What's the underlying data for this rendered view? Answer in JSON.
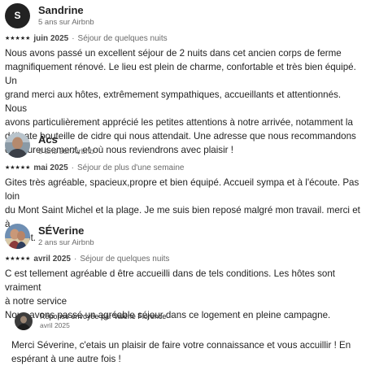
{
  "reviews": [
    {
      "avatar_letter": "S",
      "name": "Sandrine",
      "since": "5 ans sur Airbnb",
      "stars": "★★★★★",
      "date": "juin 2025",
      "stay": "Séjour de quelques nuits",
      "text": "Nous avons passé un excellent séjour de 2 nuits dans cet ancien corps de ferme\nmagnifiquement rénové. Le lieu est plein de charme, confortable et très bien équipé. Un\ngrand merci aux hôtes, extrêmement sympathiques, accueillants et attentionnés. Nous\navons particulièrement apprécié les petites attentions à notre arrivée, notamment la\ndélicate bouteille de cidre qui nous attendait. Une adresse que nous recommandons\nchaleureusement, et où nous reviendrons avec plaisir !"
    },
    {
      "name": "Acs",
      "since": "6 ans sur Airbnb",
      "stars": "★★★★★",
      "date": "mai 2025",
      "stay": "Séjour de plus d'une semaine",
      "text": "Gites très agréable, spacieux,propre et bien équipé. Accueil sympa et à l'écoute.  Pas loin\ndu Mont Saint Michel et la plage.  Je me suis bien reposé malgré mon travail. merci et à\nbientôt."
    },
    {
      "name": "SÉVerine",
      "since": "2 ans sur Airbnb",
      "stars": "★★★★★",
      "date": "avril 2025",
      "stay": "Séjour de quelques nuits",
      "text": "C est tellement agréable d être accueilli dans de tels conditions.  Les hôtes sont vraiment\nà notre service\nNous avons passé un agréable séjour dans ce logement en pleine campagne."
    }
  ],
  "reply": {
    "by": "Réponse envoyée par Valérie Florence",
    "date": "avril 2025",
    "text": "Merci Séverine, c'etais un plaisir de faire votre connaissance et vous accuillir ! En\nespérant à une autre fois !"
  },
  "colors": {
    "text": "#222222",
    "muted": "#6a6a6a",
    "background": "#ffffff"
  }
}
